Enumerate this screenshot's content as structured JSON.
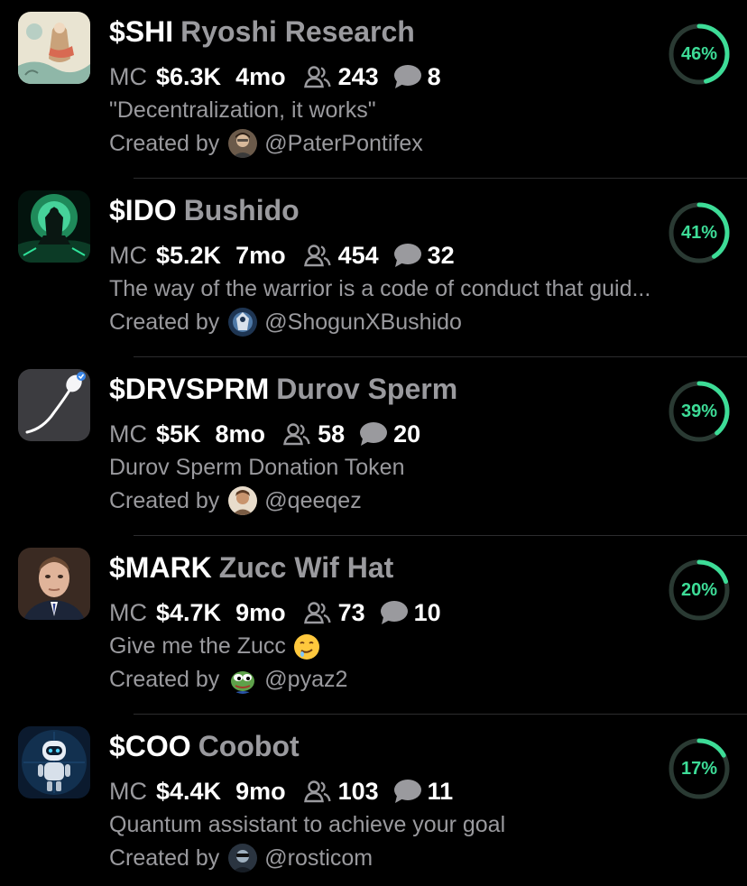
{
  "colors": {
    "background": "#000000",
    "primary_text": "#ffffff",
    "secondary_text": "#9a9a9e",
    "progress_accent": "#3ddc97",
    "progress_track": "#2a3a33"
  },
  "labels": {
    "mc": "MC",
    "created_by": "Created by"
  },
  "icons": {
    "holders": "people-icon",
    "comments": "chat-bubble-icon"
  },
  "tokens": [
    {
      "ticker": "$SHI",
      "name": "Ryoshi Research",
      "market_cap": "$6.3K",
      "age": "4mo",
      "holders": "243",
      "comments": "8",
      "description": "\"Decentralization, it works\"",
      "creator": "@PaterPontifex",
      "progress": 46,
      "progress_label": "46%"
    },
    {
      "ticker": "$IDO",
      "name": "Bushido",
      "market_cap": "$5.2K",
      "age": "7mo",
      "holders": "454",
      "comments": "32",
      "description": "The way of the warrior is a code of conduct that guid...",
      "creator": "@ShogunXBushido",
      "progress": 41,
      "progress_label": "41%"
    },
    {
      "ticker": "$DRVSPRM",
      "name": "Durov Sperm",
      "market_cap": "$5K",
      "age": "8mo",
      "holders": "58",
      "comments": "20",
      "description": "Durov Sperm Donation Token",
      "creator": "@qeeqez",
      "progress": 39,
      "progress_label": "39%"
    },
    {
      "ticker": "$MARK",
      "name": "Zucc Wif Hat",
      "market_cap": "$4.7K",
      "age": "9mo",
      "holders": "73",
      "comments": "10",
      "description": "Give me the Zucc",
      "description_emoji": "drooling-face-emoji",
      "creator": "@pyaz2",
      "progress": 20,
      "progress_label": "20%"
    },
    {
      "ticker": "$COO",
      "name": "Coobot",
      "market_cap": "$4.4K",
      "age": "9mo",
      "holders": "103",
      "comments": "11",
      "description": "Quantum assistant to achieve your goal",
      "creator": "@rosticom",
      "progress": 17,
      "progress_label": "17%"
    }
  ]
}
